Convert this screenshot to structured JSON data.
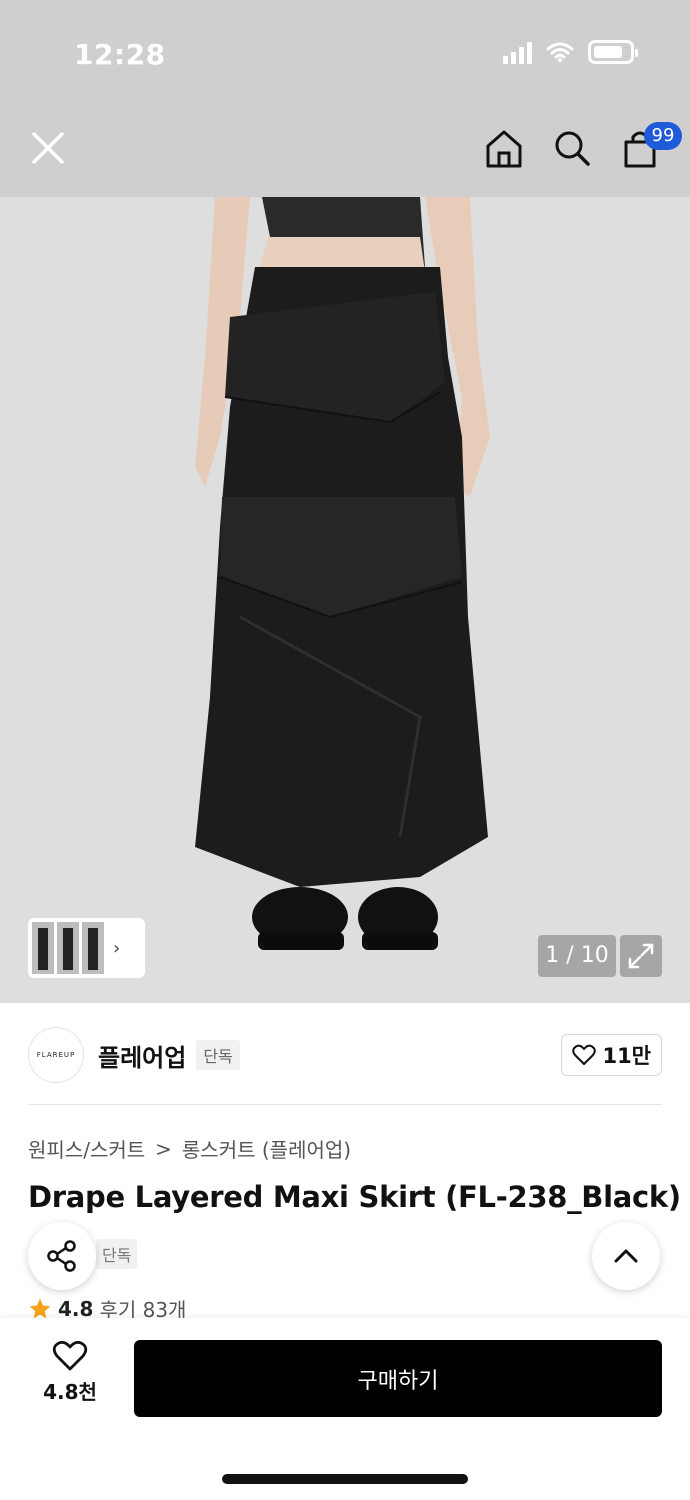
{
  "status_bar": {
    "time": "12:28"
  },
  "header": {
    "close_icon": "close-icon",
    "home_icon": "home-icon",
    "search_icon": "search-icon",
    "cart_icon": "shopping-bag-icon",
    "cart_badge": "99",
    "badge_color": "#1f5bd8"
  },
  "gallery": {
    "counter": "1 / 10",
    "expand_icon": "expand-icon"
  },
  "brand": {
    "logo_text": "FLAREUP",
    "name": "플레어업",
    "tag": "단독",
    "favorite_count": "11만"
  },
  "breadcrumb": {
    "level1": "원피스/스커트",
    "separator": ">",
    "level2": "롱스커트 (플레어업)"
  },
  "product": {
    "title": "Drape Layered Maxi Skirt (FL-238_Black)",
    "sub_tag": "단독",
    "rating": "4.8",
    "reviews": "후기 83개"
  },
  "footer": {
    "wish_count": "4.8천",
    "buy_label": "구매하기"
  }
}
